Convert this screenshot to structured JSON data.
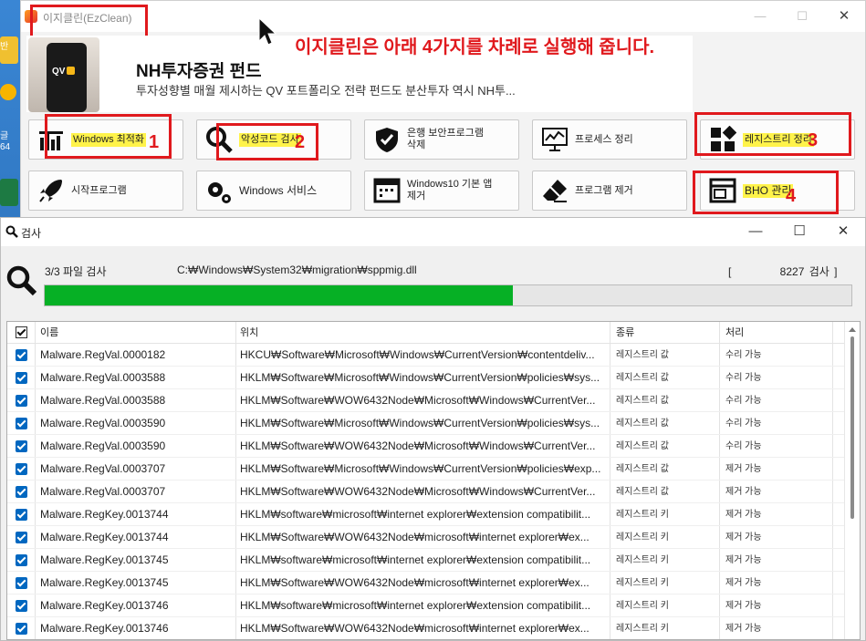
{
  "desktop": {
    "labels": [
      "반",
      "글",
      "64"
    ]
  },
  "main_window": {
    "title": "이지클린(EzClean)",
    "controls": {
      "minimize": "—",
      "maximize": "☐",
      "close": "✕"
    },
    "banner": {
      "brand": "QV",
      "title": "NH투자증권 펀드",
      "subtitle": "투자성향별 매월 제시하는 QV 포트폴리오 전략 펀드도 분산투자 역시 NH투..."
    },
    "annotation": "이지클린은 아래 4가지를 차례로 실행해 줍니다.",
    "tools": [
      {
        "label": "Windows 최적화",
        "icon": "chart-bars-icon",
        "number": "1",
        "highlight": true
      },
      {
        "label": "악성코드 검사",
        "icon": "magnifier-icon",
        "number": "2",
        "highlight": true
      },
      {
        "label": "은행 보안프로그램\n삭제",
        "icon": "shield-check-icon",
        "number": "",
        "highlight": false
      },
      {
        "label": "프로세스 정리",
        "icon": "monitor-graph-icon",
        "number": "",
        "highlight": false
      },
      {
        "label": "레지스트리 정리",
        "icon": "blocks-icon",
        "number": "3",
        "highlight": true
      },
      {
        "label": "시작프로그램",
        "icon": "rocket-icon",
        "number": "",
        "highlight": false
      },
      {
        "label": "Windows 서비스",
        "icon": "gears-icon",
        "number": "",
        "highlight": false
      },
      {
        "label": "Windows10 기본 앱\n제거",
        "icon": "app-window-icon",
        "number": "",
        "highlight": false
      },
      {
        "label": "프로그램 제거",
        "icon": "eraser-icon",
        "number": "",
        "highlight": false
      },
      {
        "label": "BHO 관리",
        "icon": "browser-window-icon",
        "number": "4",
        "highlight": true
      }
    ]
  },
  "scan_window": {
    "title": "검사",
    "controls": {
      "minimize": "—",
      "maximize": "☐",
      "close": "✕"
    },
    "progress": {
      "label": "3/3 파일 검사",
      "path": "C:₩Windows₩System32₩migration₩sppmig.dll",
      "count_text": "[          8227 검사 ]",
      "fraction": 0.58
    },
    "columns": [
      "이름",
      "위치",
      "종류",
      "처리"
    ],
    "rows": [
      [
        "Malware.RegVal.0000182",
        "HKCU₩Software₩Microsoft₩Windows₩CurrentVersion₩contentdeliv...",
        "레지스트리 값",
        "수리 가능"
      ],
      [
        "Malware.RegVal.0003588",
        "HKLM₩Software₩Microsoft₩Windows₩CurrentVersion₩policies₩sys...",
        "레지스트리 값",
        "수리 가능"
      ],
      [
        "Malware.RegVal.0003588",
        "HKLM₩Software₩WOW6432Node₩Microsoft₩Windows₩CurrentVer...",
        "레지스트리 값",
        "수리 가능"
      ],
      [
        "Malware.RegVal.0003590",
        "HKLM₩Software₩Microsoft₩Windows₩CurrentVersion₩policies₩sys...",
        "레지스트리 값",
        "수리 가능"
      ],
      [
        "Malware.RegVal.0003590",
        "HKLM₩Software₩WOW6432Node₩Microsoft₩Windows₩CurrentVer...",
        "레지스트리 값",
        "수리 가능"
      ],
      [
        "Malware.RegVal.0003707",
        "HKLM₩Software₩Microsoft₩Windows₩CurrentVersion₩policies₩exp...",
        "레지스트리 값",
        "제거 가능"
      ],
      [
        "Malware.RegVal.0003707",
        "HKLM₩Software₩WOW6432Node₩Microsoft₩Windows₩CurrentVer...",
        "레지스트리 값",
        "제거 가능"
      ],
      [
        "Malware.RegKey.0013744",
        "HKLM₩software₩microsoft₩internet explorer₩extension compatibilit...",
        "레지스트리 키",
        "제거 가능"
      ],
      [
        "Malware.RegKey.0013744",
        "HKLM₩Software₩WOW6432Node₩microsoft₩internet explorer₩ex...",
        "레지스트리 키",
        "제거 가능"
      ],
      [
        "Malware.RegKey.0013745",
        "HKLM₩software₩microsoft₩internet explorer₩extension compatibilit...",
        "레지스트리 키",
        "제거 가능"
      ],
      [
        "Malware.RegKey.0013745",
        "HKLM₩Software₩WOW6432Node₩microsoft₩internet explorer₩ex...",
        "레지스트리 키",
        "제거 가능"
      ],
      [
        "Malware.RegKey.0013746",
        "HKLM₩software₩microsoft₩internet explorer₩extension compatibilit...",
        "레지스트리 키",
        "제거 가능"
      ],
      [
        "Malware.RegKey.0013746",
        "HKLM₩Software₩WOW6432Node₩microsoft₩internet explorer₩ex...",
        "레지스트리 키",
        "제거 가능"
      ]
    ]
  },
  "colors": {
    "accent_red": "#e0191d",
    "highlight_yellow": "#fff34a",
    "progress_green": "#06b025",
    "checkbox_blue": "#0067c0"
  }
}
